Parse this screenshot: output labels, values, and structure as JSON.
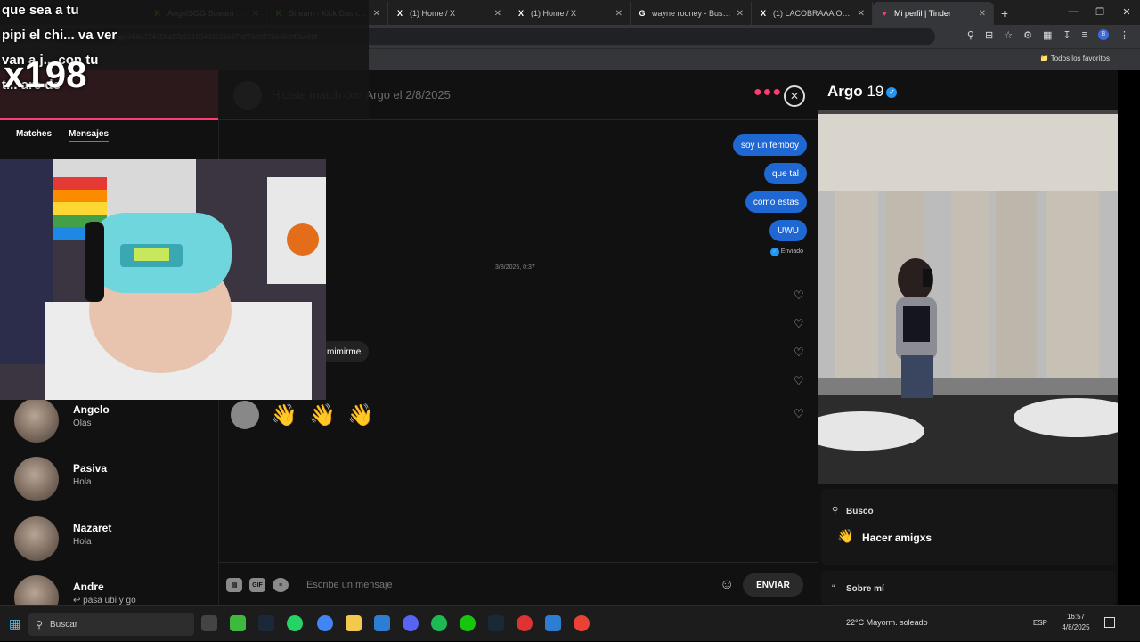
{
  "browser": {
    "tabs": [
      {
        "title": "AngelSGG Stream - Wat...",
        "favicon": "kick-icon",
        "color": "#53fc18"
      },
      {
        "title": "Stream - Kick Dashboard",
        "favicon": "kick-icon",
        "color": "#53fc18"
      },
      {
        "title": "(1) Home / X",
        "favicon": "x-icon",
        "color": "#ffffff"
      },
      {
        "title": "(1) Home / X",
        "favicon": "x-icon",
        "color": "#ffffff"
      },
      {
        "title": "wayne rooney - Buscar co...",
        "favicon": "google-icon",
        "color": "#ffffff"
      },
      {
        "title": "(1) LACOBRAAA Out of C...",
        "favicon": "x-icon",
        "color": "#ffffff"
      },
      {
        "title": "Mi perfil | Tinder",
        "favicon": "tinder-icon",
        "color": "#fe3c72",
        "active": true
      }
    ],
    "url": "...com/app/messages/66a73475bd17b50100482e26e67fdf7689976c48ef49cc80f",
    "bookmarks_label": "Todos los favoritos"
  },
  "overlay": {
    "lines": [
      "que sea a tu",
      "pipi el chi... va ver",
      "van a j... con tu",
      "t... are de"
    ],
    "counter": "x198"
  },
  "left_panel": {
    "tabs": [
      "Matches",
      "Mensajes"
    ],
    "active_tab": "Mensajes",
    "conversations": [
      {
        "name": "Angelo",
        "message": "Olas"
      },
      {
        "name": "Pasiva",
        "message": "Hola"
      },
      {
        "name": "Nazaret",
        "message": "Hola"
      },
      {
        "name": "Andre",
        "message": "↩ pasa ubi y go"
      }
    ]
  },
  "chat": {
    "header_text": "Hiciste match con Argo el 2/8/2025",
    "messages_sent": [
      "soy un femboy",
      "que tal",
      "como estas",
      "UWU"
    ],
    "sent_status": "Enviado",
    "timestamp": "3/8/2025, 0:37",
    "received_partial": "mimirme",
    "emoji_message": [
      "👋",
      "👋",
      "👋"
    ],
    "input_placeholder": "Escribe un mensaje",
    "send_label": "ENVIAR",
    "gif_label": "GIF"
  },
  "profile": {
    "name": "Argo",
    "age": "19",
    "looking_for_label": "Busco",
    "looking_for_value": "Hacer amigxs",
    "looking_for_emoji": "👋",
    "about_label": "Sobre mí"
  },
  "taskbar": {
    "search_placeholder": "Buscar",
    "weather": "22°C  Mayorm. soleado",
    "language": "ESP",
    "time": "16:57",
    "date": "4/8/2025"
  },
  "colors": {
    "tinder_accent": "#fe3c72",
    "sent_bubble": "#1f67d2",
    "verified_blue": "#2196f3"
  }
}
